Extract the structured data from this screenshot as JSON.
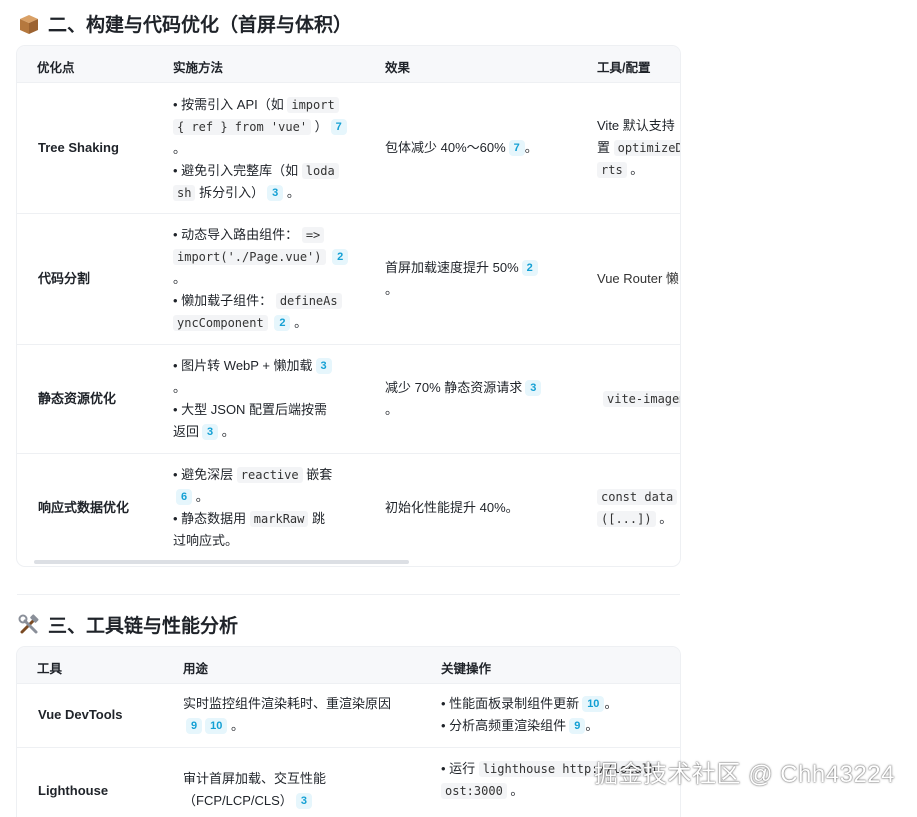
{
  "section2": {
    "icon": "box-icon",
    "title": "二、构建与代码优化（首屏与体积）",
    "headers": [
      "优化点",
      "实施方法",
      "效果",
      "工具/配置"
    ],
    "rows": [
      {
        "point": "Tree Shaking",
        "method": [
          {
            "pre": "按需引入 API（如 ",
            "code": "import { ref } from 'vue'",
            "post": "）",
            "refs": [
              "7"
            ],
            "tail": "。"
          },
          {
            "pre": "避免引入完整库（如 ",
            "code": "lodash",
            "post": " 拆分引入）",
            "refs": [
              "3"
            ],
            "tail": "。"
          }
        ],
        "effect": {
          "text": "包体减少 40%～60%",
          "refs": [
            "7"
          ],
          "tail": "。"
        },
        "tool": {
          "text": "Vite 默认支持",
          "line2_pre": "置 ",
          "code": "optimizeDeps",
          "line3": "rts 。"
        }
      },
      {
        "point": "代码分割",
        "method": [
          {
            "pre": "动态导入路由组件：",
            "code": "=> import('./Page.vue')",
            "post": "",
            "refs": [
              "2"
            ],
            "tail": "。"
          },
          {
            "pre": "懒加载子组件：",
            "code": "defineAsyncComponent",
            "post": "",
            "refs": [
              "2"
            ],
            "tail": "。"
          }
        ],
        "effect": {
          "text": "首屏加载速度提升 50%",
          "refs": [
            "2"
          ],
          "tail": "。"
        },
        "tool": {
          "text": "Vue Router 懒"
        }
      },
      {
        "point": "静态资源优化",
        "method": [
          {
            "pre": "图片转 WebP + 懒加载",
            "code": "",
            "post": "",
            "refs": [
              "3"
            ],
            "tail": "。"
          },
          {
            "pre": "大型 JSON 配置后端按需返回",
            "code": "",
            "post": "",
            "refs": [
              "3"
            ],
            "tail": "。"
          }
        ],
        "effect": {
          "text": "减少 70% 静态资源请求",
          "refs": [
            "3"
          ],
          "tail": "。"
        },
        "tool": {
          "code": "vite-imagemin"
        }
      },
      {
        "point": "响应式数据优化",
        "method": [
          {
            "pre": "避免深层 ",
            "code": "reactive",
            "post": " 嵌套",
            "refs": [
              "6"
            ],
            "tail": "。"
          },
          {
            "pre": "静态数据用 ",
            "code": "markRaw",
            "post": " 跳过响应式。",
            "refs": [],
            "tail": ""
          }
        ],
        "effect": {
          "text": "初始化性能提升 40%。",
          "refs": [],
          "tail": ""
        },
        "tool": {
          "code": "const data",
          "line2": "([...]) 。"
        }
      }
    ]
  },
  "section3": {
    "icon": "tools-icon",
    "title": "三、工具链与性能分析",
    "headers": [
      "工具",
      "用途",
      "关键操作"
    ],
    "rows": [
      {
        "tool": "Vue DevTools",
        "usage": "实时监控组件渲染耗时、重渲染原因",
        "usage_refs": [
          "9",
          "10"
        ],
        "ops": [
          {
            "text": "性能面板录制组件更新",
            "refs": [
              "10"
            ],
            "tail": "。"
          },
          {
            "text": "分析高频重渲染组件",
            "refs": [
              "9"
            ],
            "tail": "。"
          }
        ]
      },
      {
        "tool": "Lighthouse",
        "usage": "审计首屏加载、交互性能",
        "usage2": "（FCP/LCP/CLS）",
        "usage_refs": [
          "3"
        ],
        "ops": [
          {
            "pre": "运行 ",
            "code": "lighthouse http://localh",
            "line2": "ost:3000 。"
          }
        ]
      }
    ]
  },
  "watermark": "掘金技术社区 @ Chh43224"
}
